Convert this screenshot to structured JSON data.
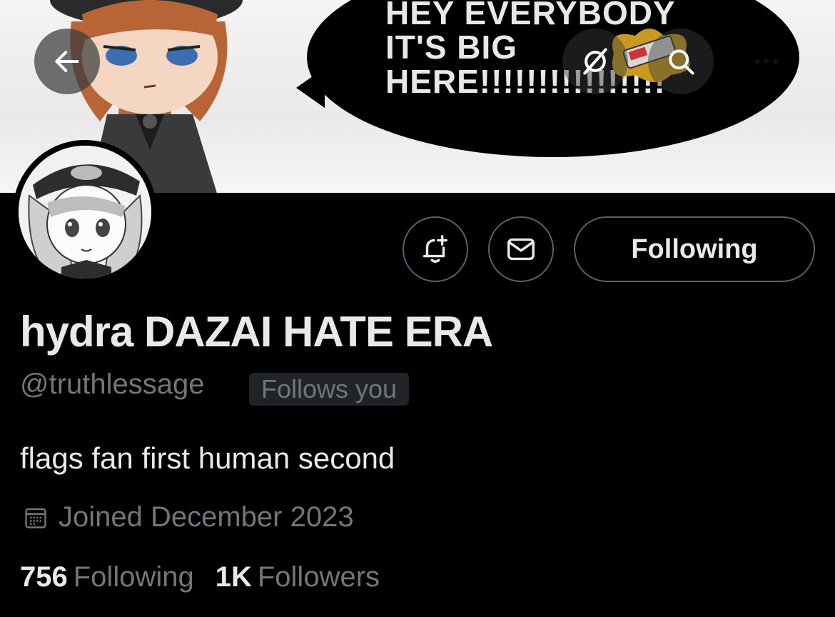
{
  "banner": {
    "speech_text": "HEY EVERYBODY\nIT'S BIG\nHERE!!!!!!!!!!!!!!!!"
  },
  "nav": {
    "back_icon": "arrow-left-icon",
    "grok_icon": "grok-icon",
    "search_icon": "search-icon",
    "more_icon": "more-horizontal-icon"
  },
  "actions": {
    "notify_icon": "bell-plus-icon",
    "message_icon": "envelope-icon",
    "following_label": "Following"
  },
  "profile": {
    "display_name": "hydra DAZAI HATE ERA",
    "handle": "@truthlessage",
    "follows_you": "Follows you",
    "bio": "flags fan first human second",
    "joined": "Joined December 2023",
    "following_count": "756",
    "following_label": "Following",
    "followers_count": "1K",
    "followers_label": "Followers"
  },
  "colors": {
    "background": "#000000",
    "primary_text": "#e7e9ea",
    "secondary_text": "#71767b",
    "border": "#536471",
    "badge_bg": "#202327"
  }
}
